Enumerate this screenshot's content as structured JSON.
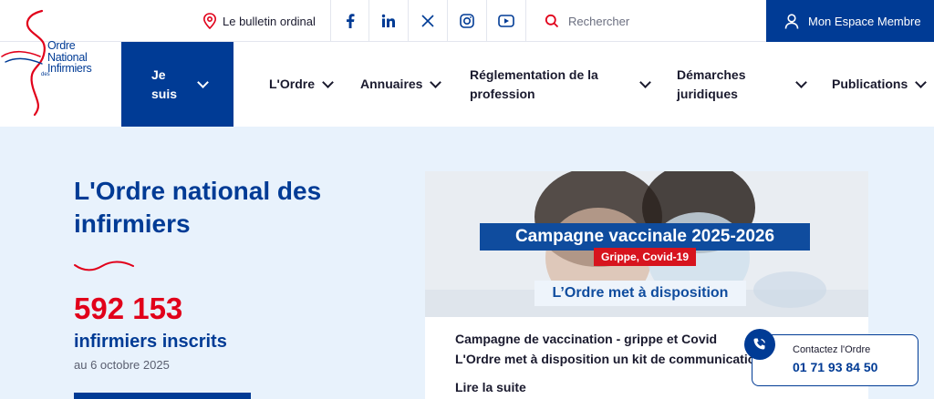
{
  "logo": {
    "line1": "Ordre",
    "line2": "National",
    "line3": "Infirmiers",
    "small": "des"
  },
  "topbar": {
    "bulletin": "Le bulletin ordinal",
    "search_placeholder": "Rechercher",
    "member_label": "Mon Espace Membre",
    "social": [
      "facebook-icon",
      "linkedin-icon",
      "x-icon",
      "instagram-icon",
      "youtube-icon"
    ]
  },
  "nav": {
    "jesuis": "Je suis",
    "items": [
      "L'Ordre",
      "Annuaires",
      "Réglementation de la profession",
      "Démarches juridiques",
      "Publications"
    ]
  },
  "hero": {
    "title": "L'Ordre national des infirmiers",
    "count": "592 153",
    "count_label": "infirmiers inscrits",
    "count_date": "au 6 octobre 2025"
  },
  "card": {
    "banner": "Campagne vaccinale 2025-2026",
    "banner_sub": "Grippe, Covid-19",
    "banner_tag": "L’Ordre met à disposition",
    "title_line1": "Campagne de vaccination - grippe et Covid",
    "title_line2": "L'Ordre met à disposition un kit de communication",
    "link": "Lire la suite"
  },
  "contact": {
    "label": "Contactez l'Ordre",
    "phone": "01 71 93 84 50"
  },
  "colors": {
    "primary": "#003b95",
    "accent": "#e1001a",
    "hero_bg": "#e8f2fc"
  }
}
